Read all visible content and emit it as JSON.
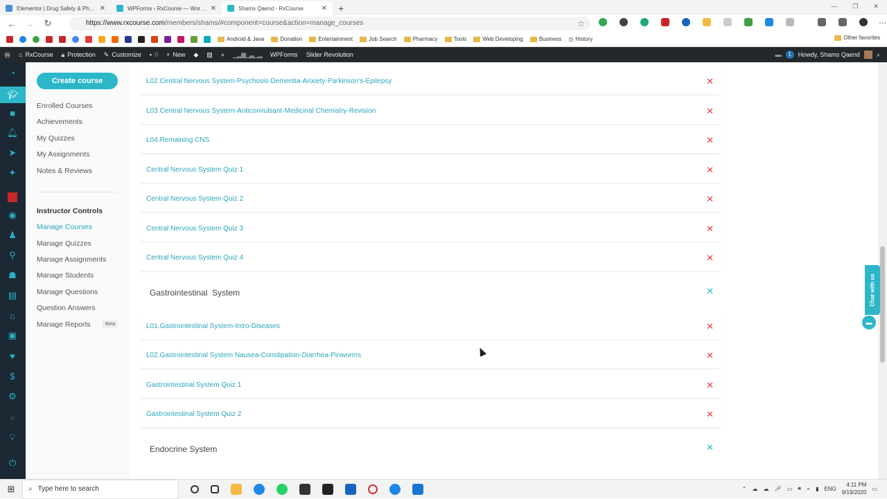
{
  "browser": {
    "tabs": [
      {
        "title": "Elementor | Drug Safety & Pharm",
        "color": "#4a90d9",
        "active": false
      },
      {
        "title": "WPForms ‹ RxCourse — WordPr",
        "color": "#2bb7c8",
        "active": false
      },
      {
        "title": "Shams Qaend - RxCourse",
        "color": "#2bb7c8",
        "active": true
      }
    ],
    "url_domain": "https://www.rxcourse.com",
    "url_path": "/members/shams/#component=course&action=manage_courses",
    "bookmarks": [
      "Android & Java",
      "Donation",
      "Entertainment",
      "Job Search",
      "Pharmacy",
      "Tools",
      "Web Developing",
      "Business",
      "History"
    ],
    "other_favorites": "Other favorites"
  },
  "wpadmin": {
    "site": "RxCourse",
    "protection": "Protection",
    "customize": "Customize",
    "comments": "0",
    "new": "New",
    "wpforms": "WPForms",
    "slider": "Slider Revolution",
    "notif_count": "1",
    "howdy": "Howdy, Shams Qaend"
  },
  "leftnav": {
    "create_course": "Create course",
    "links": [
      "Enrolled Courses",
      "Achievements",
      "My Quizzes",
      "My Assignments",
      "Notes & Reviews"
    ],
    "instructor_heading": "Instructor Controls",
    "instructor_links": [
      "Manage Courses",
      "Manage Quizzes",
      "Manage Assignments",
      "Manage Students",
      "Manage Questions",
      "Question Answers",
      "Manage Reports"
    ],
    "beta": "Beta"
  },
  "curriculum": {
    "units": [
      "L02.Central Nervous System-Psychosis-Dementia-Anxiety-Parkinson's-Epilepsy",
      "L03.Central Nervous System-Anticonvulsant-Medicinal Chemistry-Revision",
      "L04.Remaining CNS",
      "Central Nervous System Quiz 1",
      "Central Nervous System Quiz 2",
      "Central Nervous System Quiz 3",
      "Central Nervous System Quiz 4"
    ],
    "section_gi": "Gastrointestinal  System",
    "gi_units": [
      "L01.Gastrointestinal System-Intro-Diseases",
      "L02.Gastrointestinal System Nausea-Constipation-Diarrhea-Pinworms",
      "Gastrointestinal System Quiz 1",
      "Gastrointestinal System Quiz 2"
    ],
    "section_endocrine": "Endocrine System",
    "delete_symbol": "✕"
  },
  "chat": {
    "label": "Chat with us"
  },
  "taskbar": {
    "search_placeholder": "Type here to search",
    "lang": "ENG",
    "time": "4:11 PM",
    "date": "9/19/2020"
  }
}
